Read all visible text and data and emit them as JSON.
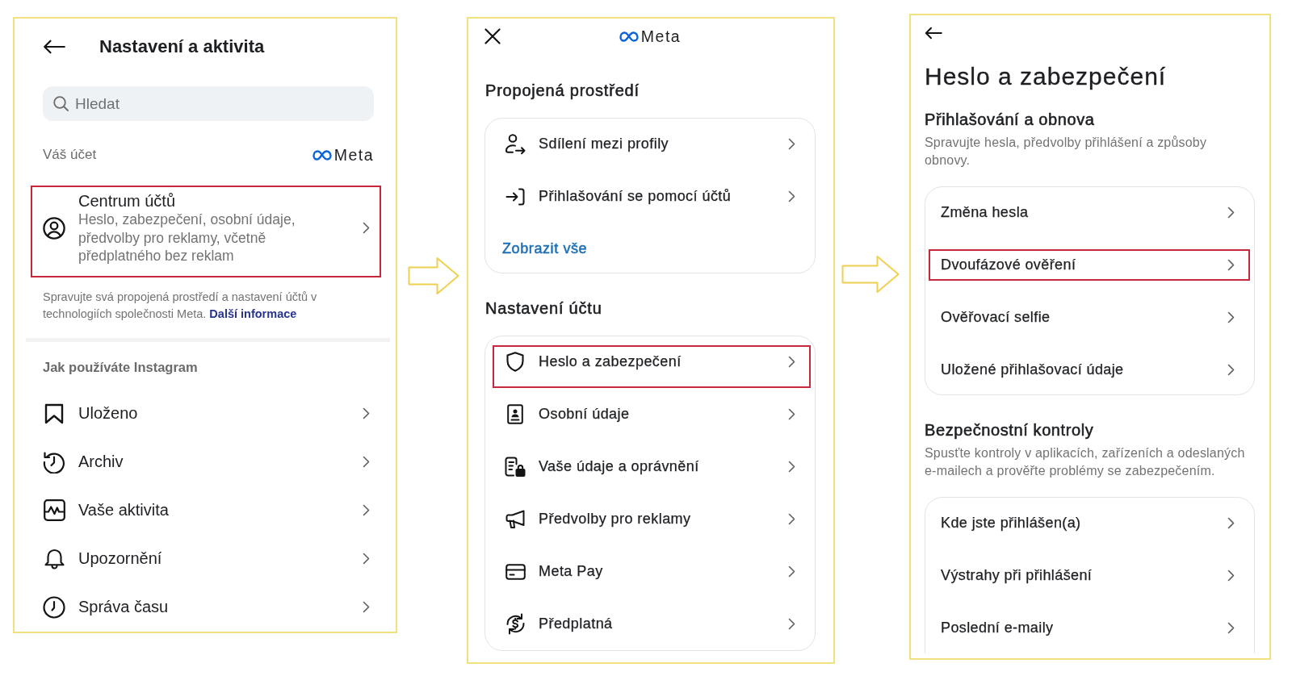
{
  "settings_screen": {
    "title": "Nastavení a aktivita",
    "search": {
      "placeholder": "Hledat"
    },
    "account_label": "Váš účet",
    "brand": "Meta",
    "accounts_center": {
      "title": "Centrum účtů",
      "description": "Heslo, zabezpečení, osobní údaje, předvolby pro reklamy, včetně předplatného bez reklam",
      "highlighted": true
    },
    "note": {
      "text": "Spravujte svá propojená prostředí a nastavení účtů v technologiích společnosti Meta.",
      "link": "Další informace"
    },
    "section": {
      "title": "Jak používáte Instagram",
      "items": [
        {
          "label": "Uloženo",
          "highlighted": false
        },
        {
          "label": "Archiv",
          "highlighted": false
        },
        {
          "label": "Vaše aktivita",
          "highlighted": false
        },
        {
          "label": "Upozornění",
          "highlighted": false
        },
        {
          "label": "Správa času",
          "highlighted": false
        }
      ]
    }
  },
  "accounts_center_screen": {
    "brand": "Meta",
    "sections": [
      {
        "title": "Propojená prostředí",
        "items": [
          {
            "label": "Sdílení mezi profily",
            "highlighted": false
          },
          {
            "label": "Přihlašování se pomocí účtů",
            "highlighted": false
          }
        ],
        "link": "Zobrazit vše"
      },
      {
        "title": "Nastavení účtu",
        "items": [
          {
            "label": "Heslo a zabezpečení",
            "highlighted": true
          },
          {
            "label": "Osobní údaje",
            "highlighted": false
          },
          {
            "label": "Vaše údaje a oprávnění",
            "highlighted": false
          },
          {
            "label": "Předvolby pro reklamy",
            "highlighted": false
          },
          {
            "label": "Meta Pay",
            "highlighted": false
          },
          {
            "label": "Předplatná",
            "highlighted": false
          }
        ]
      }
    ]
  },
  "password_security_screen": {
    "title": "Heslo a zabezpečení",
    "sections": [
      {
        "title": "Přihlašování a obnova",
        "description": "Spravujte hesla, předvolby přihlášení a způsoby obnovy.",
        "items": [
          {
            "label": "Změna hesla",
            "highlighted": false
          },
          {
            "label": "Dvoufázové ověření",
            "highlighted": true
          },
          {
            "label": "Ověřovací selfie",
            "highlighted": false
          },
          {
            "label": "Uložené přihlašovací údaje",
            "highlighted": false
          }
        ]
      },
      {
        "title": "Bezpečnostní kontroly",
        "description": "Spusťte kontroly v aplikacích, zařízeních a odeslaných e-mailech a prověřte problémy se zabezpečením.",
        "items": [
          {
            "label": "Kde jste přihlášen(a)",
            "highlighted": false
          },
          {
            "label": "Výstrahy při přihlášení",
            "highlighted": false
          },
          {
            "label": "Poslední e-maily",
            "highlighted": false
          }
        ]
      }
    ]
  }
}
